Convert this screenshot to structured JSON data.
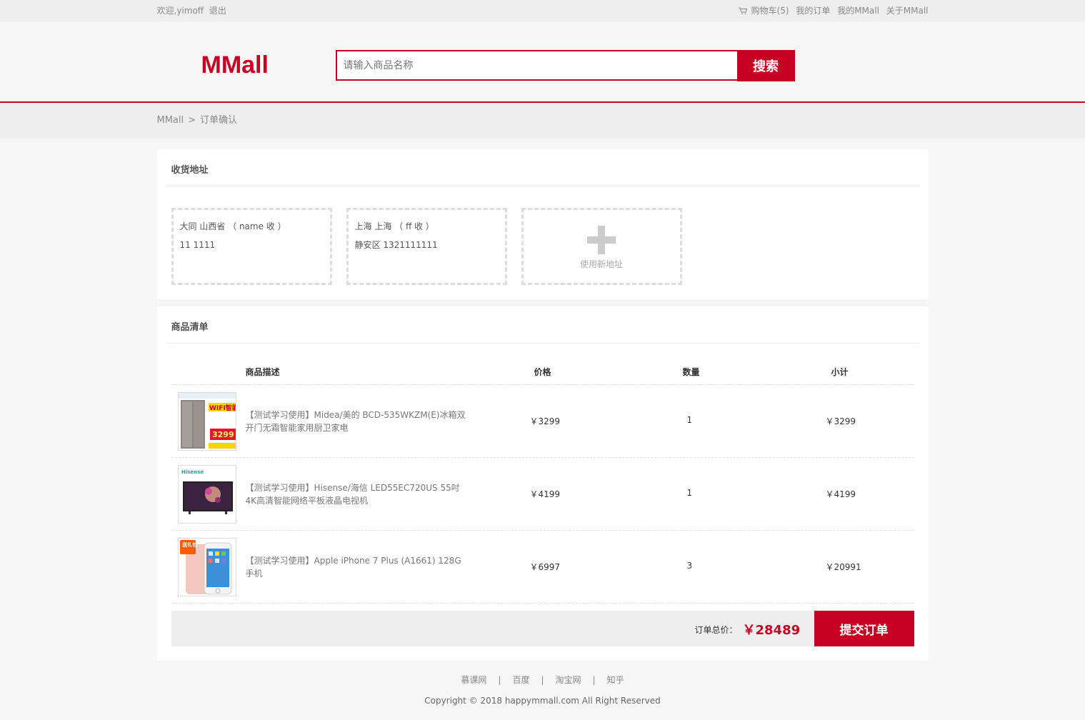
{
  "topbar": {
    "welcome": "欢迎,yimoff",
    "logout": "退出",
    "cart": "购物车(5)",
    "orders": "我的订单",
    "my": "我的MMall",
    "about": "关于MMall"
  },
  "header": {
    "logo": "MMall",
    "search_placeholder": "请输入商品名称",
    "search_button": "搜索"
  },
  "crumb": {
    "home": "MMall",
    "sep": ">",
    "current": "订单确认"
  },
  "address": {
    "title": "收货地址",
    "items": [
      {
        "line1": "大同 山西省 （ name 收 ）",
        "line2": "11 1111"
      },
      {
        "line1": "上海 上海 （ ff 收 ）",
        "line2": "静安区 1321111111"
      }
    ],
    "new_label": "使用新地址"
  },
  "products": {
    "title": "商品清单",
    "columns": [
      "商品描述",
      "价格",
      "数量",
      "小计"
    ],
    "rows": [
      {
        "desc": "【测试学习使用】Midea/美的 BCD-535WKZM(E)冰箱双开门无霜智能家用厨卫家电",
        "price": "￥3299",
        "qty": "1",
        "subtotal": "￥3299",
        "image": "fridge-image"
      },
      {
        "desc": "【测试学习使用】Hisense/海信 LED55EC720US 55吋4K高清智能网络平板液晶电视机",
        "price": "￥4199",
        "qty": "1",
        "subtotal": "￥4199",
        "image": "tv-image"
      },
      {
        "desc": "【测试学习使用】Apple iPhone 7 Plus (A1661) 128G手机",
        "price": "￥6997",
        "qty": "3",
        "subtotal": "￥20991",
        "image": "phone-image"
      }
    ],
    "image_texts": {
      "fridge_badge": "WIFI智能",
      "fridge_price": "3299",
      "tv_brand": "Hisense",
      "phone_badge": "送礼包"
    }
  },
  "order": {
    "total_label": "订单总价：",
    "total_value": "￥28489",
    "submit": "提交订单"
  },
  "footer": {
    "links": [
      "慕课网",
      "百度",
      "淘宝网",
      "知乎"
    ],
    "sep": "|",
    "copyright": "Copyright © 2018 happymmall.com All Right Reserved"
  },
  "colors": {
    "brand": "#c60023",
    "bg": "#f6f6f6"
  }
}
